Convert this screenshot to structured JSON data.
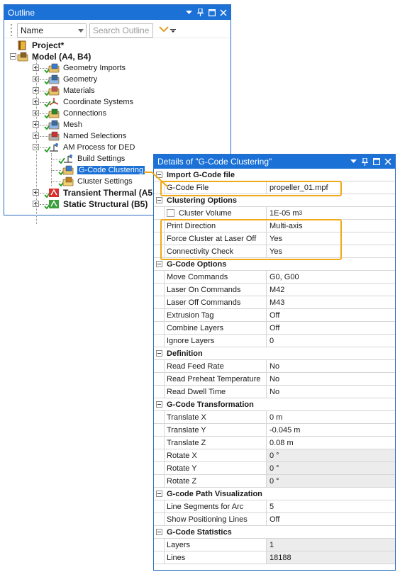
{
  "outline": {
    "title": "Outline",
    "sort_select_value": "Name",
    "search_placeholder": "Search Outline",
    "tree": [
      {
        "label": "Project*",
        "icon": "project-icon",
        "bold": true,
        "check": false
      },
      {
        "label": "Model (A4, B4)",
        "icon": "model-icon",
        "bold": true,
        "check": false
      },
      {
        "label": "Geometry Imports",
        "icon": "geometry-imports-icon",
        "check": true
      },
      {
        "label": "Geometry",
        "icon": "geometry-icon",
        "check": true
      },
      {
        "label": "Materials",
        "icon": "materials-icon",
        "check": true
      },
      {
        "label": "Coordinate Systems",
        "icon": "coordinate-systems-icon",
        "check": true
      },
      {
        "label": "Connections",
        "icon": "connections-icon",
        "check": true
      },
      {
        "label": "Mesh",
        "icon": "mesh-icon",
        "check": true
      },
      {
        "label": "Named Selections",
        "icon": "named-selections-icon",
        "check": false
      },
      {
        "label": "AM Process for DED",
        "icon": "am-process-icon",
        "check": true
      },
      {
        "label": "Build Settings",
        "icon": "build-settings-icon",
        "check": true
      },
      {
        "label": "G-Code Clustering",
        "icon": "gcode-clustering-icon",
        "check": true,
        "selected": true
      },
      {
        "label": "Cluster Settings",
        "icon": "cluster-settings-icon",
        "check": true
      },
      {
        "label": "Transient Thermal (A5",
        "icon": "transient-thermal-icon",
        "bold": true,
        "check": true
      },
      {
        "label": "Static Structural (B5)",
        "icon": "static-structural-icon",
        "bold": true,
        "check": true
      }
    ]
  },
  "details": {
    "title": "Details of \"G-Code Clustering\"",
    "sections": [
      {
        "label": "Import G-Code file",
        "rows": [
          {
            "key": "G-Code File",
            "value": "propeller_01.mpf"
          }
        ]
      },
      {
        "label": "Clustering Options",
        "rows": [
          {
            "key": "Cluster Volume",
            "value": "1E-05 m",
            "unit_sup": "3",
            "checkbox": true
          },
          {
            "key": "Print Direction",
            "value": "Multi-axis"
          },
          {
            "key": "Force Cluster at Laser Off",
            "value": "Yes"
          },
          {
            "key": "Connectivity Check",
            "value": "Yes"
          }
        ]
      },
      {
        "label": "G-Code Options",
        "rows": [
          {
            "key": "Move Commands",
            "value": "G0, G00"
          },
          {
            "key": "Laser On Commands",
            "value": "M42"
          },
          {
            "key": "Laser Off Commands",
            "value": "M43"
          },
          {
            "key": "Extrusion Tag",
            "value": "Off"
          },
          {
            "key": "Combine Layers",
            "value": "Off"
          },
          {
            "key": "Ignore Layers",
            "value": "0"
          }
        ]
      },
      {
        "label": "Definition",
        "rows": [
          {
            "key": "Read Feed Rate",
            "value": "No"
          },
          {
            "key": "Read Preheat Temperature",
            "value": "No"
          },
          {
            "key": "Read Dwell Time",
            "value": "No"
          }
        ]
      },
      {
        "label": "G-Code Transformation",
        "rows": [
          {
            "key": "Translate X",
            "value": "0 m"
          },
          {
            "key": "Translate Y",
            "value": "-0.045 m"
          },
          {
            "key": "Translate Z",
            "value": "0.08 m"
          },
          {
            "key": "Rotate X",
            "value": "0 °",
            "readonly": true
          },
          {
            "key": "Rotate Y",
            "value": "0 °",
            "readonly": true
          },
          {
            "key": "Rotate Z",
            "value": "0 °",
            "readonly": true
          }
        ]
      },
      {
        "label": "G-code Path Visualization",
        "rows": [
          {
            "key": "Line Segments for Arc",
            "value": "5"
          },
          {
            "key": "Show Positioning Lines",
            "value": "Off"
          }
        ]
      },
      {
        "label": "G-Code Statistics",
        "rows": [
          {
            "key": "Layers",
            "value": "1",
            "readonly": true
          },
          {
            "key": "Lines",
            "value": "18188",
            "readonly": true
          }
        ]
      }
    ]
  },
  "colors": {
    "titlebar": "#1c71d6",
    "highlight": "#f2a917",
    "check": "#1a9a1a"
  }
}
